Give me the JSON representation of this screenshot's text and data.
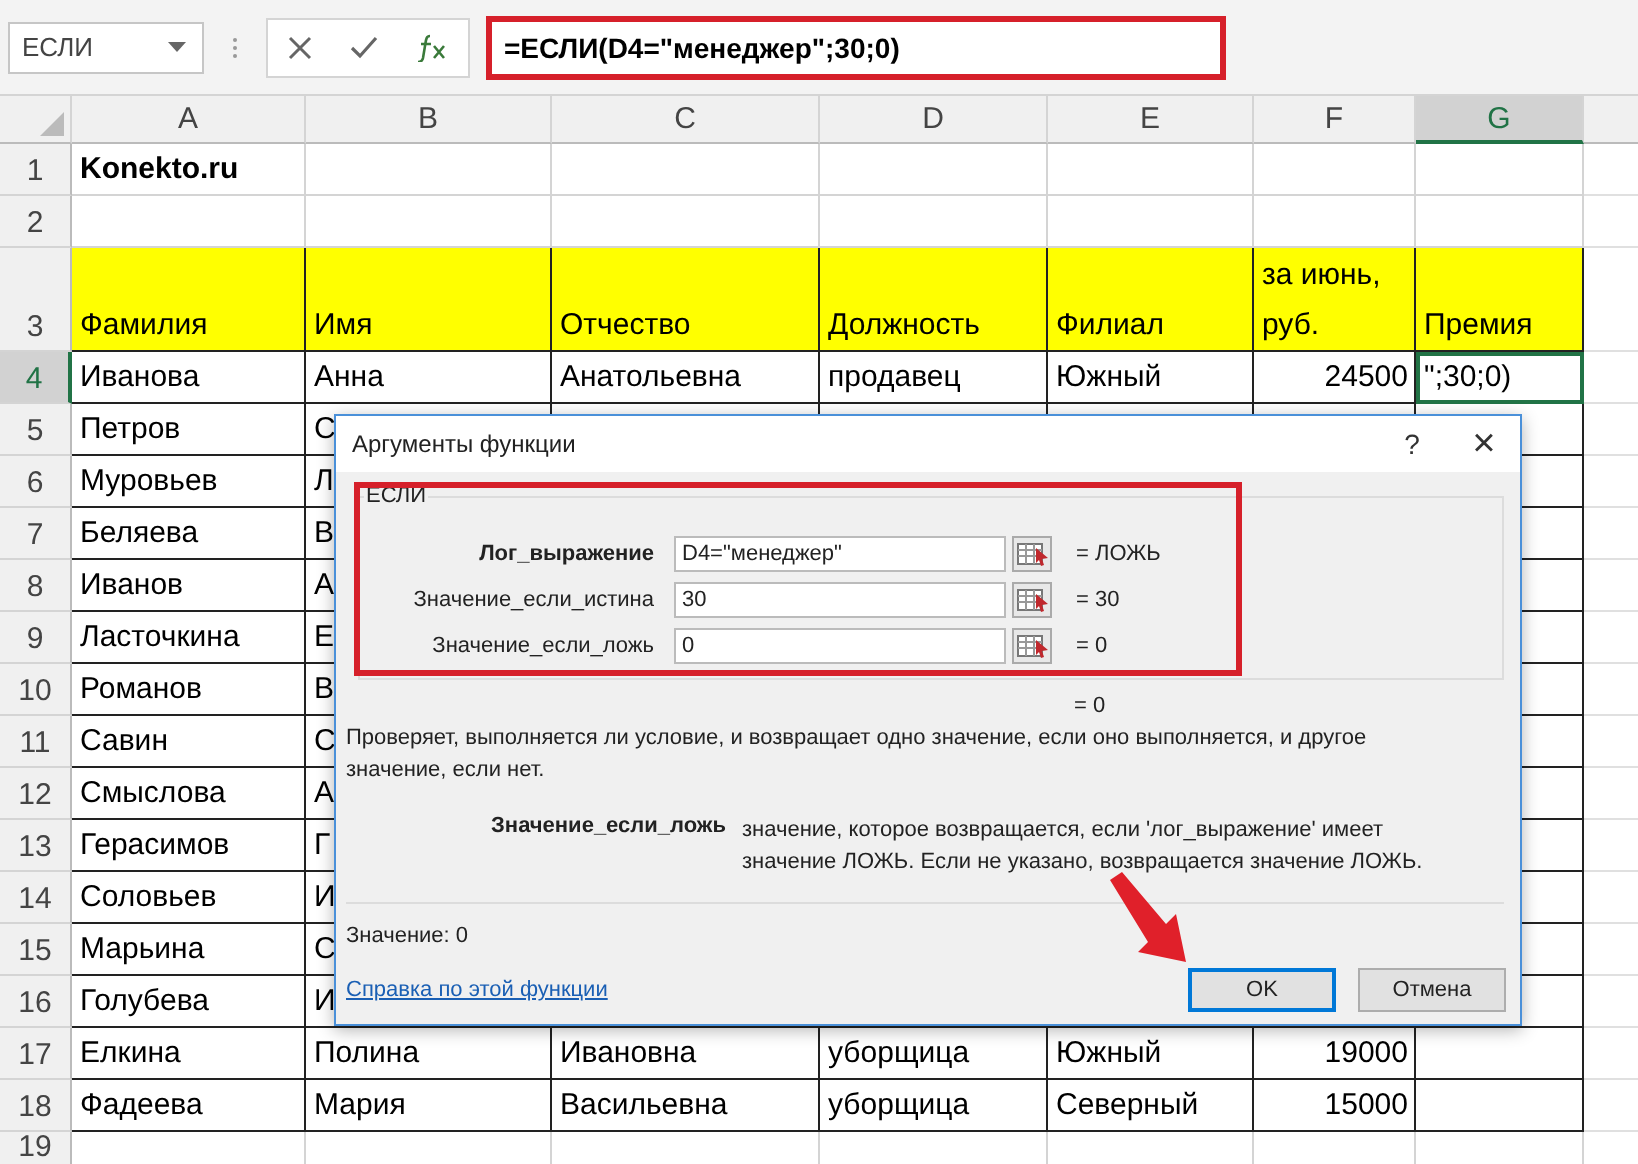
{
  "formula_bar": {
    "name_box": "ЕСЛИ",
    "formula": "=ЕСЛИ(D4=\"менеджер\";30;0)"
  },
  "columns": [
    {
      "label": "A",
      "selected": false
    },
    {
      "label": "B",
      "selected": false
    },
    {
      "label": "C",
      "selected": false
    },
    {
      "label": "D",
      "selected": false
    },
    {
      "label": "E",
      "selected": false
    },
    {
      "label": "F",
      "selected": false
    },
    {
      "label": "G",
      "selected": true
    }
  ],
  "rows": [
    {
      "number": "1",
      "kind": "title",
      "selected": false,
      "A": "Konekto.ru"
    },
    {
      "number": "2",
      "kind": "plain",
      "selected": false
    },
    {
      "number": "3",
      "kind": "header",
      "selected": false,
      "A": "Фамилия",
      "B": "Имя",
      "C": "Отчество",
      "D": "Должность",
      "E": "Филиал",
      "F": "за июнь, руб.",
      "G": "Премия"
    },
    {
      "number": "4",
      "kind": "plain",
      "selected": true,
      "A": "Иванова",
      "B": "Анна",
      "C": "Анатольевна",
      "D": "продавец",
      "E": "Южный",
      "F": {
        "text": "24500",
        "kind": "number"
      },
      "G": {
        "text": "\";30;0)",
        "selected": true
      }
    },
    {
      "number": "5",
      "kind": "plain",
      "selected": false,
      "A": "Петров",
      "B": "С"
    },
    {
      "number": "6",
      "kind": "plain",
      "selected": false,
      "A": "Муровьев",
      "B": "Л"
    },
    {
      "number": "7",
      "kind": "plain",
      "selected": false,
      "A": "Беляева",
      "B": "В"
    },
    {
      "number": "8",
      "kind": "plain",
      "selected": false,
      "A": "Иванов",
      "B": "А"
    },
    {
      "number": "9",
      "kind": "plain",
      "selected": false,
      "A": "Ласточкина",
      "B": "Е"
    },
    {
      "number": "10",
      "kind": "plain",
      "selected": false,
      "A": "Романов",
      "B": "В"
    },
    {
      "number": "11",
      "kind": "plain",
      "selected": false,
      "A": "Савин",
      "B": "С"
    },
    {
      "number": "12",
      "kind": "plain",
      "selected": false,
      "A": "Смыслова",
      "B": "А"
    },
    {
      "number": "13",
      "kind": "plain",
      "selected": false,
      "A": "Герасимов",
      "B": "Г"
    },
    {
      "number": "14",
      "kind": "plain",
      "selected": false,
      "A": "Соловьев",
      "B": "И"
    },
    {
      "number": "15",
      "kind": "plain",
      "selected": false,
      "A": "Марьина",
      "B": "С"
    },
    {
      "number": "16",
      "kind": "plain",
      "selected": false,
      "A": "Голубева",
      "B": "И"
    },
    {
      "number": "17",
      "kind": "plain",
      "selected": false,
      "A": "Елкина",
      "B": "Полина",
      "C": "Ивановна",
      "D": "уборщица",
      "E": "Южный",
      "F": {
        "text": "19000",
        "kind": "number"
      }
    },
    {
      "number": "18",
      "kind": "plain",
      "selected": false,
      "A": "Фадеева",
      "B": "Мария",
      "C": "Васильевна",
      "D": "уборщица",
      "E": "Северный",
      "F": {
        "text": "15000",
        "kind": "number"
      }
    },
    {
      "number": "19",
      "kind": "plain",
      "selected": false
    }
  ],
  "dialog": {
    "title": "Аргументы функции",
    "help": "?",
    "close": "×",
    "group": "ЕСЛИ",
    "arguments": [
      {
        "label": "Лог_выражение",
        "value": "D4=\"менеджер\"",
        "result": "= ЛОЖЬ",
        "current": true
      },
      {
        "label": "Значение_если_истина",
        "value": "30",
        "result": "= 30",
        "current": false
      },
      {
        "label": "Значение_если_ложь",
        "value": "0",
        "result": "= 0",
        "current": false
      }
    ],
    "formula_result": "= 0",
    "description": "Проверяет, выполняется ли условие, и возвращает одно значение, если оно выполняется, и другое значение, если нет.",
    "argument_help": {
      "label": "Значение_если_ложь",
      "text": "значение, которое возвращается, если 'лог_выражение' имеет значение ЛОЖЬ. Если не указано, возвращается значение ЛОЖЬ."
    },
    "value_line": "Значение:  0",
    "help_link": "Справка по этой функции",
    "buttons": [
      {
        "label": "OK",
        "default": true
      },
      {
        "label": "Отмена",
        "default": false
      }
    ]
  }
}
